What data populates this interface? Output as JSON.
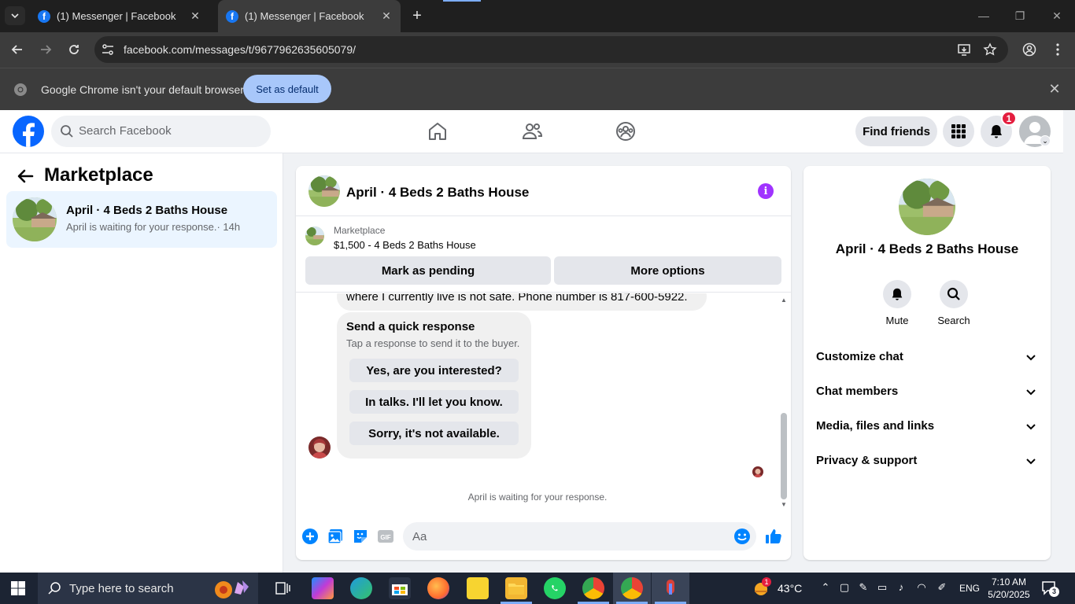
{
  "browser": {
    "tabs": [
      {
        "title": "(1) Messenger | Facebook",
        "active": false
      },
      {
        "title": "(1) Messenger | Facebook",
        "active": true
      }
    ],
    "url": "facebook.com/messages/t/9677962635605079/",
    "infobar": {
      "text": "Google Chrome isn't your default browser",
      "button": "Set as default"
    }
  },
  "fb_header": {
    "search_placeholder": "Search Facebook",
    "find_friends": "Find friends",
    "notification_count": "1"
  },
  "sidebar": {
    "title": "Marketplace",
    "conversations": [
      {
        "name": "April · 4 Beds 2 Baths House",
        "preview": "April is waiting for your response.",
        "time": "· 14h"
      }
    ]
  },
  "chat": {
    "title": "April · 4 Beds 2 Baths House",
    "listing": {
      "category": "Marketplace",
      "price_title": "$1,500 - 4 Beds 2 Baths House",
      "mark_pending": "Mark as pending",
      "more_options": "More options"
    },
    "previous_message": "where I currently live is not safe. Phone number is 817-600-5922.",
    "quick_response": {
      "title": "Send a quick response",
      "subtitle": "Tap a response to send it to the buyer.",
      "options": [
        "Yes, are you interested?",
        "In talks. I'll let you know.",
        "Sorry, it's not available."
      ]
    },
    "waiting_text": "April is waiting for your response.",
    "composer_placeholder": "Aa"
  },
  "info_panel": {
    "name": "April · 4 Beds 2 Baths House",
    "actions": [
      {
        "label": "Mute"
      },
      {
        "label": "Search"
      }
    ],
    "sections": [
      "Customize chat",
      "Chat members",
      "Media, files and links",
      "Privacy & support"
    ]
  },
  "taskbar": {
    "search_placeholder": "Type here to search",
    "temperature": "43°C",
    "language": "ENG",
    "time": "7:10 AM",
    "date": "5/20/2025",
    "notification_count": "3",
    "weather_badge": "1"
  },
  "colors": {
    "fb_blue": "#0866ff",
    "messenger_blue": "#0084ff",
    "info_purple": "#a033ff",
    "active_conv_bg": "#ebf5ff"
  }
}
